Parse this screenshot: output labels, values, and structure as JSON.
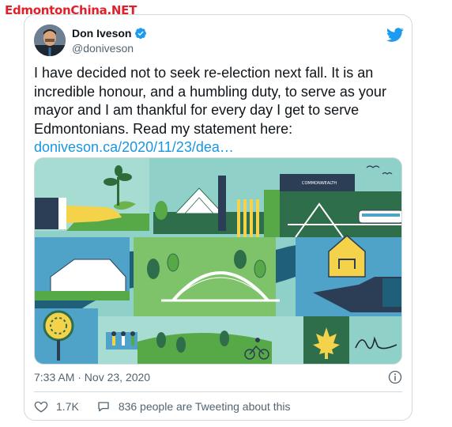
{
  "watermark": {
    "text": "EdmontonChina.NET"
  },
  "author": {
    "name": "Don Iveson",
    "handle": "@doniveson",
    "verified": true
  },
  "tweet": {
    "text": "I have decided not to seek re-election next fall. It is an incredible honour, and a humbling duty, to serve as your mayor and I am thankful for every day I get to serve Edmontonians. Read my statement here:",
    "link": "doniveson.ca/2020/11/23/dea…"
  },
  "media": {
    "sign_text": "COMMONWEALTH"
  },
  "meta": {
    "timestamp": "7:33 AM · Nov 23, 2020"
  },
  "engagement": {
    "likes": "1.7K",
    "conversation": "836 people are Tweeting about this"
  },
  "colors": {
    "link": "#1b95e0",
    "twitter_blue": "#1d9bf0",
    "secondary_text": "#536471",
    "watermark_red": "#e0202a"
  },
  "icons": [
    "verified-badge-icon",
    "twitter-bird-icon",
    "info-icon",
    "heart-icon",
    "speech-bubble-icon"
  ]
}
